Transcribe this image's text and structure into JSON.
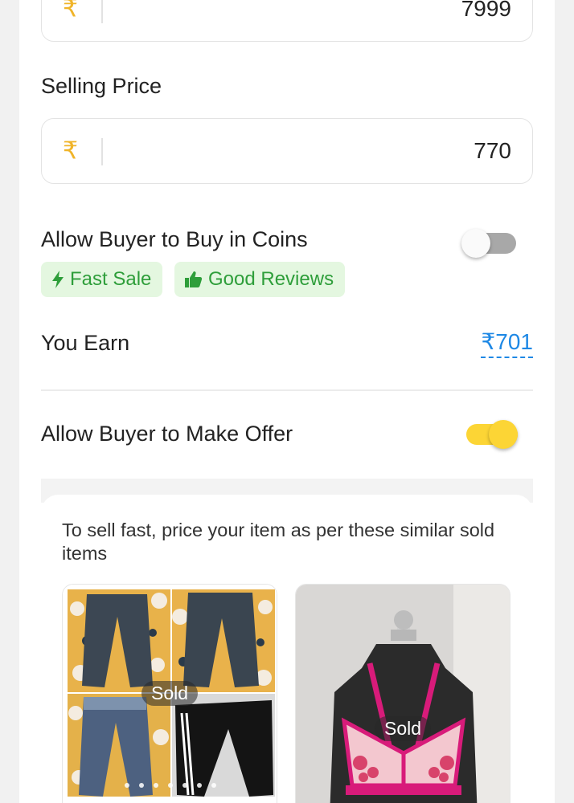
{
  "mrp": {
    "currency_symbol": "₹",
    "value": "7999"
  },
  "selling_price": {
    "label": "Selling Price",
    "currency_symbol": "₹",
    "value": "770"
  },
  "coins": {
    "label": "Allow Buyer to Buy in Coins",
    "enabled": false,
    "tags": [
      {
        "icon": "lightning-icon",
        "label": "Fast Sale"
      },
      {
        "icon": "thumbs-up-icon",
        "label": "Good Reviews"
      }
    ]
  },
  "earn": {
    "label": "You Earn",
    "value": "₹701"
  },
  "offer": {
    "label": "Allow Buyer to Make Offer",
    "enabled": true
  },
  "similar": {
    "hint": "To sell fast, price your item as per these similar sold items",
    "items": [
      {
        "badge": "Sold",
        "image": "pants-collage"
      },
      {
        "badge": "Sold",
        "image": "bra-on-mannequin"
      }
    ]
  },
  "colors": {
    "rupee": "#f0b429",
    "tag_bg": "#e4f7e0",
    "tag_text": "#2e9e3a",
    "earn_link": "#1e88e5",
    "toggle_on": "#fcd535",
    "toggle_off": "#a8a8a8"
  }
}
